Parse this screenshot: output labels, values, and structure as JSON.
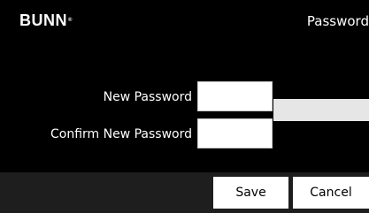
{
  "header": {
    "logo": "BUNN",
    "logo_mark": "®",
    "title": "Password"
  },
  "form": {
    "new_password": {
      "label": "New Password",
      "value": ""
    },
    "confirm_password": {
      "label": "Confirm New Password",
      "value": ""
    }
  },
  "footer": {
    "save_label": "Save",
    "cancel_label": "Cancel"
  },
  "colors": {
    "background": "#000000",
    "footer_background": "#1e1e1e",
    "input_background": "#ffffff",
    "strength_bar": "#e6e6e6",
    "text": "#ffffff"
  }
}
